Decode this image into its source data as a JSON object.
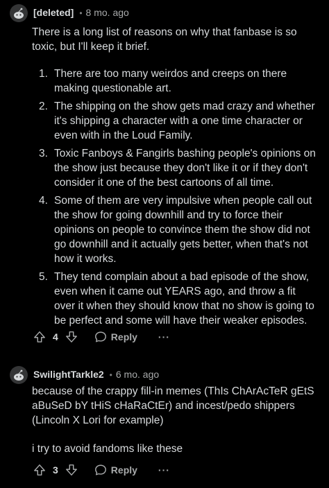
{
  "comments": [
    {
      "author": "[deleted]",
      "separator": "•",
      "time": "8 mo. ago",
      "intro": "There is a long list of reasons on why that fanbase is so toxic, but I'll keep it brief.",
      "list": [
        {
          "num": "1.",
          "text": "There are too many weirdos and creeps on there making questionable art."
        },
        {
          "num": "2.",
          "text": "The shipping on the show gets mad crazy and whether it's shipping a character with a one time character or even with in the Loud Family."
        },
        {
          "num": "3.",
          "text": "Toxic Fanboys & Fangirls bashing people's opinions on the show just because they don't like it or if they don't consider it one of the best cartoons of all time."
        },
        {
          "num": "4.",
          "text": "Some of them are very impulsive when people call out the show for going downhill and try to force their opinions on people to convince them the show did not go downhill and it actually gets better, when that's not how it works."
        },
        {
          "num": "5.",
          "text": "They tend complain about a bad episode of the show, even when it came out YEARS ago, and throw a fit over it when they should know that no show is going to be perfect and some will have their weaker episodes."
        }
      ],
      "votes": "4",
      "reply_label": "Reply",
      "more_label": "···"
    },
    {
      "author": "SwilightTarkle2",
      "separator": "•",
      "time": "6 mo. ago",
      "paragraphs": [
        "because of the crappy fill-in memes (ThIs ChArAcTeR gEtS aBuSeD bY tHiS cHaRaCtEr) and incest/pedo shippers (Lincoln X Lori for example)",
        "i try to avoid fandoms like these"
      ],
      "votes": "3",
      "reply_label": "Reply",
      "more_label": "···"
    }
  ],
  "icons": {
    "avatar": "snoo-avatar-icon",
    "upvote": "upvote-arrow-icon",
    "downvote": "downvote-arrow-icon",
    "reply": "speech-bubble-icon"
  },
  "colors": {
    "background": "#000000",
    "text": "#d7dadc",
    "meta": "#a8aaab",
    "muted": "#818384"
  }
}
